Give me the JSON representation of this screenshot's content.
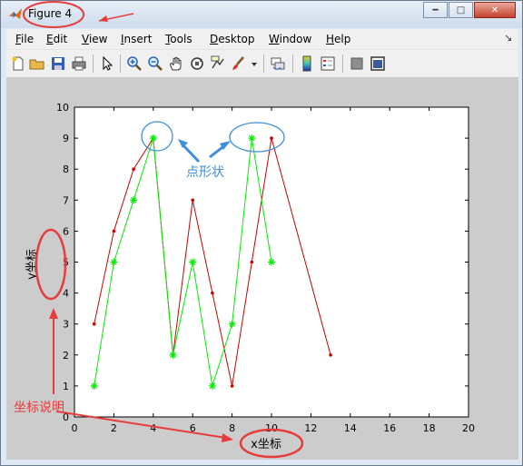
{
  "window": {
    "title": "Figure 4"
  },
  "menu": [
    {
      "label": "File",
      "mnemonic": "F",
      "rest": "ile"
    },
    {
      "label": "Edit",
      "mnemonic": "E",
      "rest": "dit"
    },
    {
      "label": "View",
      "mnemonic": "V",
      "rest": "iew"
    },
    {
      "label": "Insert",
      "mnemonic": "I",
      "rest": "nsert"
    },
    {
      "label": "Tools",
      "mnemonic": "T",
      "rest": "ools"
    },
    {
      "label": "Desktop",
      "mnemonic": "D",
      "rest": "esktop"
    },
    {
      "label": "Window",
      "mnemonic": "W",
      "rest": "indow"
    },
    {
      "label": "Help",
      "mnemonic": "H",
      "rest": "elp"
    }
  ],
  "toolbar_icons": [
    "new-figure-icon",
    "open-file-icon",
    "save-icon",
    "print-icon",
    "pointer-icon",
    "zoom-in-icon",
    "zoom-out-icon",
    "pan-hand-icon",
    "rotate-3d-icon",
    "data-cursor-icon",
    "brush-icon",
    "brush-dropdown-icon",
    "link-plot-icon",
    "colorbar-icon",
    "legend-icon",
    "hide-plot-tools-icon",
    "show-plot-tools-icon"
  ],
  "annotations": {
    "marker_shape": "点形状",
    "axis_label_note": "坐标说明"
  },
  "colors": {
    "series_red": "#cc0000",
    "series_green": "#00ee00",
    "annotation_blue": "#3c8fd8",
    "annotation_red": "#e63c3c"
  },
  "chart_data": {
    "type": "line",
    "xlabel": "x坐标",
    "ylabel": "y坐标",
    "xlim": [
      0,
      20
    ],
    "ylim": [
      0,
      10
    ],
    "xticks": [
      0,
      2,
      4,
      6,
      8,
      10,
      12,
      14,
      16,
      18,
      20
    ],
    "yticks": [
      0,
      1,
      2,
      3,
      4,
      5,
      6,
      7,
      8,
      9,
      10
    ],
    "grid": false,
    "series": [
      {
        "color": "#cc0000",
        "marker": ".",
        "x": [
          1,
          2,
          3,
          4,
          5,
          6,
          7,
          8,
          9,
          10,
          13
        ],
        "y": [
          3,
          6,
          8,
          9,
          2,
          7,
          4,
          1,
          5,
          9,
          2
        ]
      },
      {
        "color": "#00ee00",
        "marker": "*",
        "x": [
          1,
          2,
          3,
          4,
          5,
          6,
          7,
          8,
          9,
          10
        ],
        "y": [
          1,
          5,
          7,
          9,
          2,
          5,
          1,
          3,
          9,
          5
        ]
      }
    ]
  }
}
